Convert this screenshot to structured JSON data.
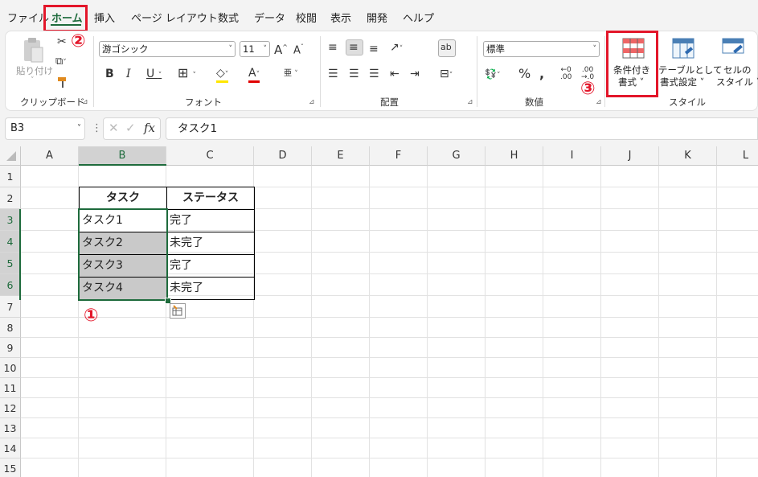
{
  "menu": [
    "ファイル",
    "ホーム",
    "挿入",
    "ページ レイアウト",
    "数式",
    "データ",
    "校閲",
    "表示",
    "開発",
    "ヘルプ"
  ],
  "ribbon": {
    "clipboard": {
      "paste": "貼り付け",
      "label": "クリップボード"
    },
    "font": {
      "name": "游ゴシック",
      "size": "11",
      "label": "フォント"
    },
    "alignment": {
      "label": "配置"
    },
    "number": {
      "format": "標準",
      "label": "数値"
    },
    "styles": {
      "cond_format": [
        "条件付き",
        "書式 ˅"
      ],
      "table_format": [
        "テーブルとして",
        "書式設定 ˅"
      ],
      "cell_styles": [
        "セルの",
        "スタイル ˅"
      ],
      "label": "スタイル"
    }
  },
  "annotations": {
    "one": "①",
    "two": "②",
    "three": "③"
  },
  "formula_bar": {
    "name_box": "B3",
    "fx": "fx",
    "content": "タスク1"
  },
  "columns": [
    "A",
    "B",
    "C",
    "D",
    "E",
    "F",
    "G",
    "H",
    "I",
    "J",
    "K",
    "L"
  ],
  "rows": [
    "1",
    "2",
    "3",
    "4",
    "5",
    "6",
    "7",
    "8",
    "9",
    "10",
    "11",
    "12",
    "13",
    "14",
    "15"
  ],
  "table": {
    "headers": [
      "タスク",
      "ステータス"
    ],
    "rows": [
      [
        "タスク1",
        "完了"
      ],
      [
        "タスク2",
        "未完了"
      ],
      [
        "タスク3",
        "完了"
      ],
      [
        "タスク4",
        "未完了"
      ]
    ]
  },
  "colors": {
    "accent_green": "#1e6b3c",
    "annotation_red": "#e3162a",
    "selection_gray": "#c9c9c9"
  }
}
